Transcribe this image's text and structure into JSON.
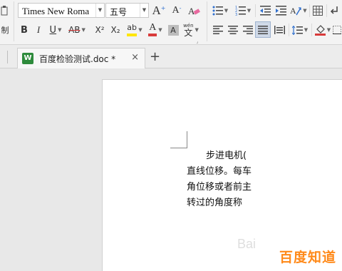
{
  "ribbon": {
    "font_name": "Times New Roma",
    "font_size": "五号",
    "grow_font": "A",
    "shrink_font": "A",
    "bold": "B",
    "italic": "I",
    "underline": "U",
    "strikethrough": "AB",
    "superscript": "X²",
    "subscript": "X₂",
    "highlight": "ab",
    "font_color": "A",
    "char_shading": "A",
    "phonetic_top": "wén",
    "phonetic_bottom": "文",
    "partial_left": "制"
  },
  "tabs": {
    "doc_name": "百度检验测试.doc *",
    "close": "×",
    "new_tab": "+"
  },
  "document": {
    "lines": [
      "步进电机(",
      "直线位移。每车",
      "角位移或者前主",
      "转过的角度称"
    ]
  },
  "watermark": {
    "brand": "百度知道",
    "faint": "Bai"
  },
  "colors": {
    "accent_blue": "#2f6fce",
    "highlight_yellow": "#ffe600",
    "font_red": "#d83b3b",
    "watermark_orange": "#ff8a1a"
  }
}
